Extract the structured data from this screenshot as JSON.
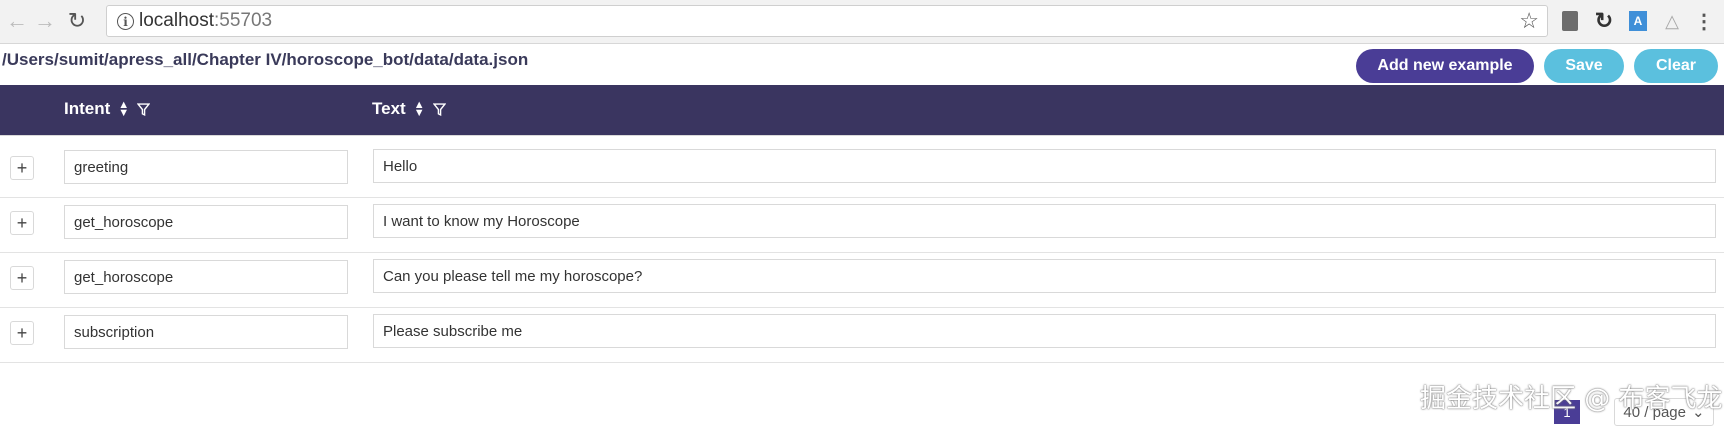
{
  "browser": {
    "url_host": "localhost",
    "url_port": ":55703"
  },
  "toolbar": {
    "file_path": "/Users/sumit/apress_all/Chapter IV/horoscope_bot/data/data.json",
    "add_label": "Add new example",
    "save_label": "Save",
    "clear_label": "Clear"
  },
  "table": {
    "columns": [
      "Intent",
      "Text"
    ],
    "rows": [
      {
        "intent": "greeting",
        "text": "Hello"
      },
      {
        "intent": "get_horoscope",
        "text": "I want to know my Horoscope"
      },
      {
        "intent": "get_horoscope",
        "text": "Can you please tell me my horoscope?"
      },
      {
        "intent": "subscription",
        "text": "Please subscribe me"
      }
    ],
    "expand_symbol": "+"
  },
  "pagination": {
    "current_page": "1",
    "page_size": "40 / page"
  },
  "watermark": "掘金技术社区 @ 布客飞龙",
  "colors": {
    "header_bg": "#3a3560",
    "primary": "#4a3d96",
    "info": "#5bc0de"
  }
}
